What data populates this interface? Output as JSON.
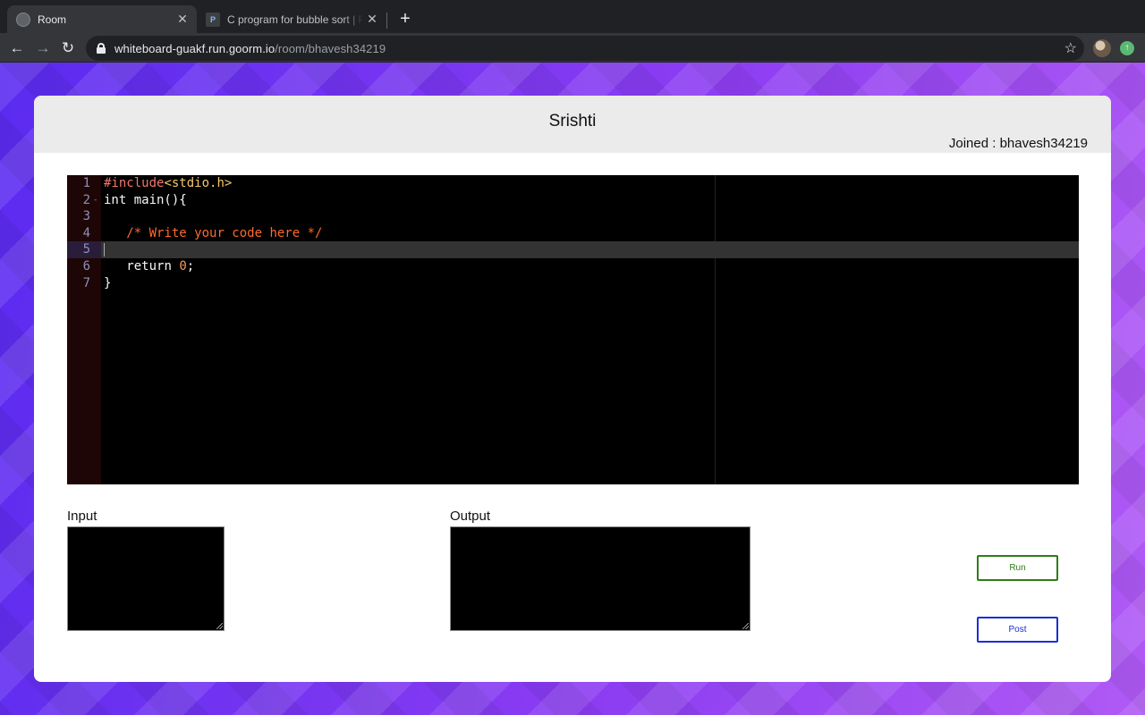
{
  "browser": {
    "tabs": [
      {
        "title": "Room",
        "active": true
      },
      {
        "title": "C program for bubble sort | Pro",
        "active": false
      }
    ],
    "new_tab": "+",
    "url_host": "whiteboard-guakf.run.goorm.io",
    "url_path": "/room/bhavesh34219",
    "icons": {
      "back": "←",
      "forward": "→",
      "reload": "↻",
      "star": "☆",
      "close": "✕"
    }
  },
  "room": {
    "title": "Srishti",
    "joined_label": "Joined : bhavesh34219"
  },
  "editor": {
    "line_numbers": [
      "1",
      "2",
      "3",
      "4",
      "5",
      "6",
      "7"
    ],
    "active_line": 5,
    "lines": {
      "l1_pre": "#include",
      "l1_inc": "<stdio.h>",
      "l2": "int main(){",
      "l4_comment": "/* Write your code here */",
      "l6_kw": "return ",
      "l6_num": "0",
      "l6_end": ";",
      "l7": "}"
    },
    "fold_marker": "-"
  },
  "io": {
    "input_label": "Input",
    "output_label": "Output"
  },
  "actions": {
    "run_label": "Run",
    "post_label": "Post"
  },
  "colors": {
    "run": "#2e7d16",
    "post": "#1a2fd6",
    "header_bg": "#ebebeb"
  }
}
